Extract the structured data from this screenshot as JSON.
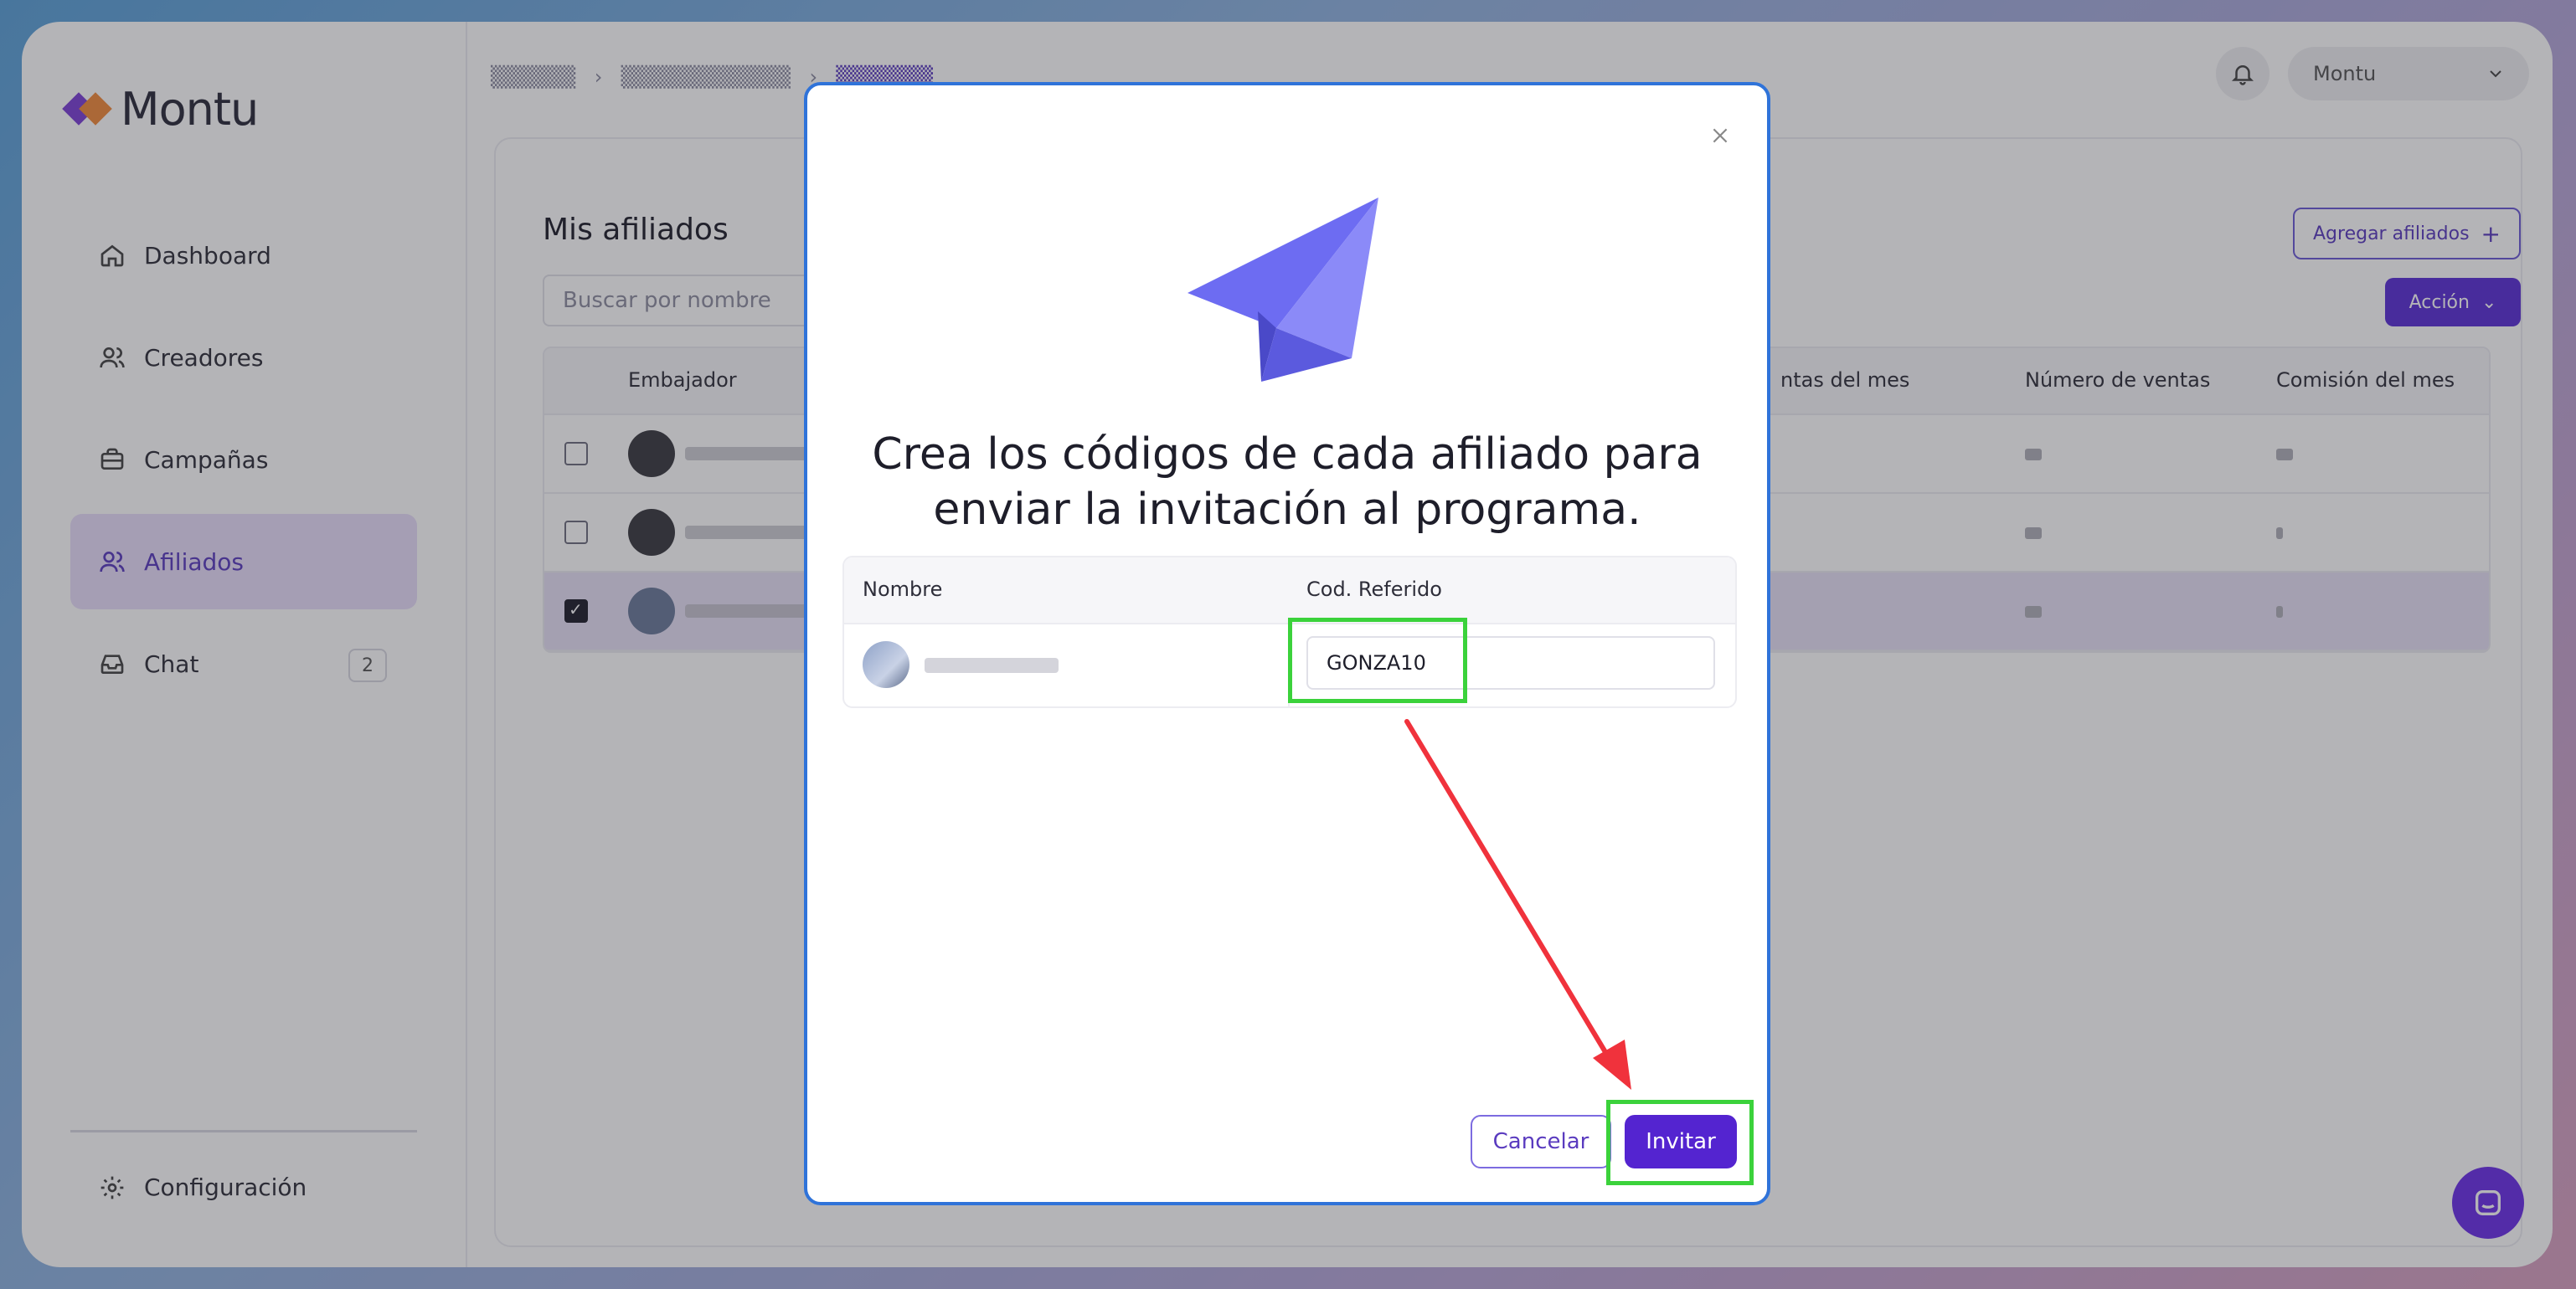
{
  "app": {
    "logo_text": "Montu"
  },
  "sidebar": {
    "items": [
      {
        "label": "Dashboard",
        "icon": "home-icon"
      },
      {
        "label": "Creadores",
        "icon": "users-icon"
      },
      {
        "label": "Campañas",
        "icon": "briefcase-icon"
      },
      {
        "label": "Afiliados",
        "icon": "users-icon",
        "active": true
      },
      {
        "label": "Chat",
        "icon": "inbox-icon",
        "badge": "2"
      }
    ],
    "settings_label": "Configuración"
  },
  "topbar": {
    "user_select": "Montu"
  },
  "page": {
    "title": "Mis afiliados",
    "search_placeholder": "Buscar por nombre",
    "add_button": "Agregar afiliados",
    "action_button": "Acción",
    "columns": [
      "Embajador",
      "ntas del mes",
      "Número de ventas",
      "Comisión del mes"
    ]
  },
  "modal": {
    "title_line1": "Crea los códigos de cada afiliado para",
    "title_line2": "enviar la invitación al programa.",
    "table_headers": [
      "Nombre",
      "Cod. Referido"
    ],
    "row_code_value": "GONZA10",
    "cancel_label": "Cancelar",
    "invite_label": "Invitar"
  },
  "colors": {
    "accent": "#5424d0",
    "highlight": "#3bd23b",
    "arrow": "#f0323c",
    "modal_border": "#2f73d9"
  }
}
